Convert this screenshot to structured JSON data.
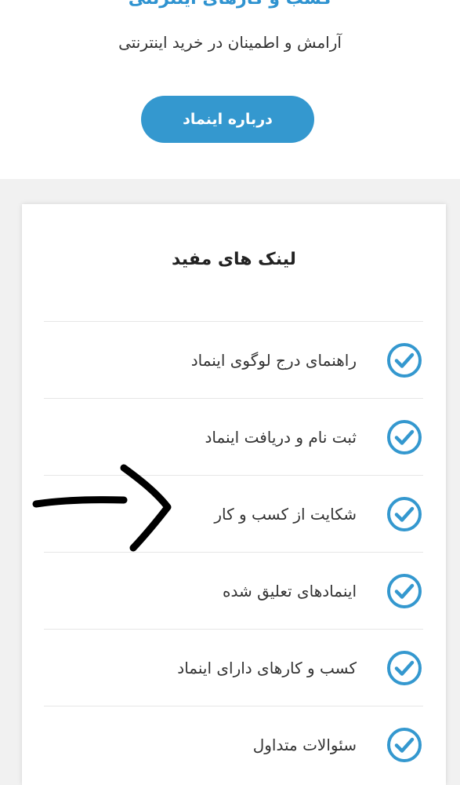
{
  "hero": {
    "heading": "کسب و کارهای اینترنتی",
    "tagline": "آرامش و اطمینان در خرید اینترنتی",
    "about_button": "درباره اینماد"
  },
  "useful_links": {
    "title": "لینک های مفید",
    "items": [
      {
        "label": "راهنمای درج لوگوی اینماد",
        "icon": "check-circle-icon"
      },
      {
        "label": "ثبت نام و دریافت اینماد",
        "icon": "check-circle-icon"
      },
      {
        "label": "شکایت از کسب و کار",
        "icon": "check-circle-icon"
      },
      {
        "label": "اینمادهای تعلیق شده",
        "icon": "check-circle-icon"
      },
      {
        "label": "کسب و کارهای دارای اینماد",
        "icon": "check-circle-icon"
      },
      {
        "label": "سئوالات متداول",
        "icon": "check-circle-icon"
      }
    ]
  },
  "colors": {
    "accent": "#3498cf",
    "heading": "#2f93d0",
    "annotation": "#000000"
  },
  "annotation": {
    "icon": "hand-drawn-arrow-icon"
  }
}
